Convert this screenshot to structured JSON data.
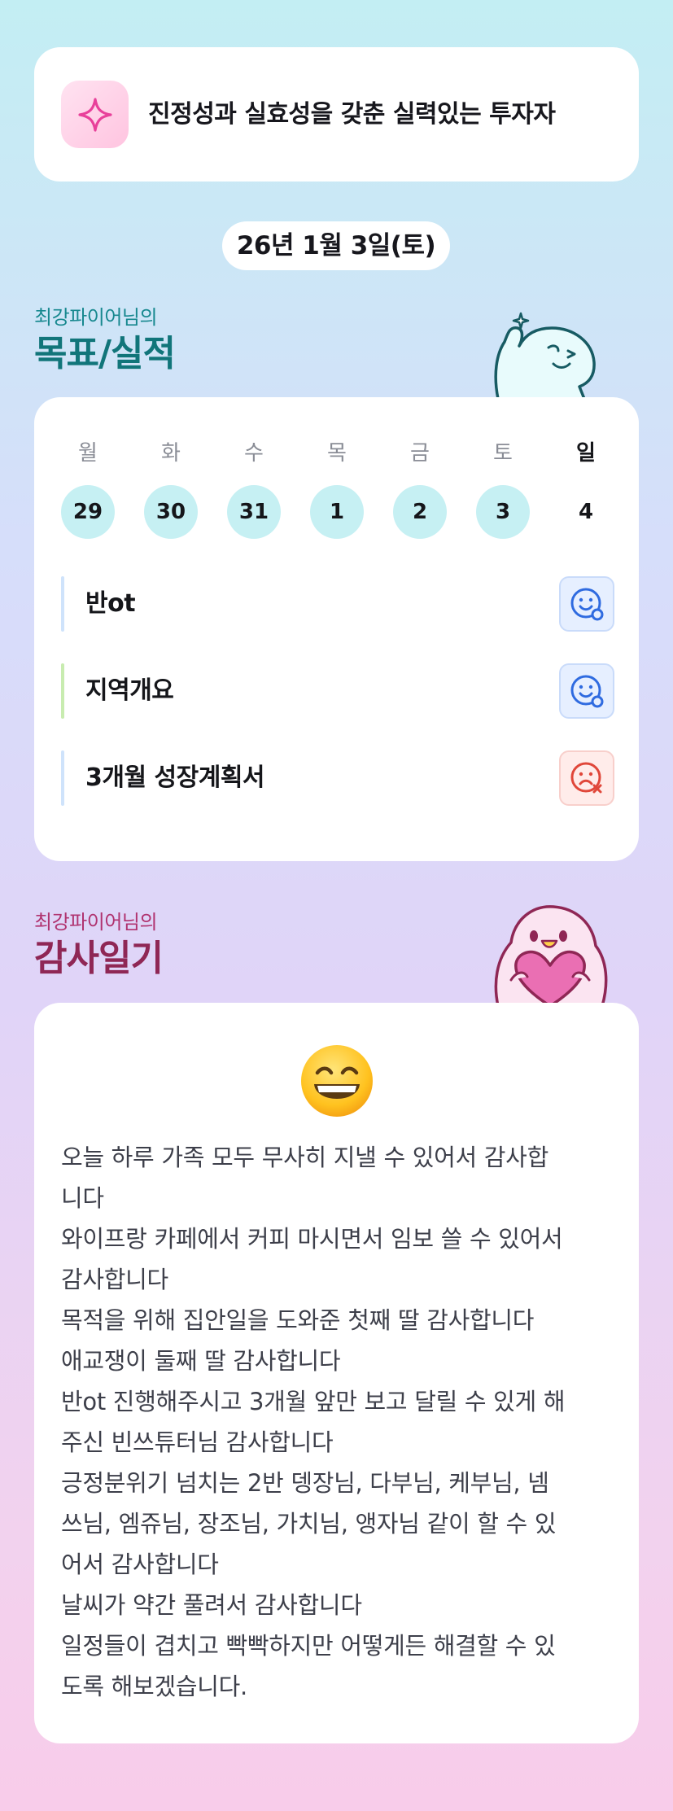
{
  "motto": {
    "icon": "sparkle-icon",
    "text": "진정성과 실효성을 갖춘 실력있는 투자자"
  },
  "date_label": "26년 1월 3일(토)",
  "goals_section": {
    "subtitle": "최강파이어님의",
    "title": "목표/실적",
    "weekdays": [
      "월",
      "화",
      "수",
      "목",
      "금",
      "토",
      "일"
    ],
    "dates": [
      "29",
      "30",
      "31",
      "1",
      "2",
      "3",
      "4"
    ],
    "tasks": [
      {
        "label": "반ot",
        "status": "smile-icon",
        "bar_color": "#cfe3fb"
      },
      {
        "label": "지역개요",
        "status": "smile-icon",
        "bar_color": "#c8ecb0"
      },
      {
        "label": "3개월 성장계획서",
        "status": "sad-x-icon",
        "bar_color": "#cfe3fb"
      }
    ]
  },
  "gratitude_section": {
    "subtitle": "최강파이어님의",
    "title": "감사일기",
    "emoji": "grinning-face-icon",
    "lines": [
      "오늘 하루 가족 모두 무사히 지낼 수 있어서 감사합",
      "니다",
      "와이프랑 카페에서 커피 마시면서 임보 쓸 수 있어서",
      "감사합니다",
      "목적을 위해 집안일을 도와준 첫째 딸 감사합니다",
      "애교쟁이 둘째 딸 감사합니다",
      "반ot 진행해주시고 3개월 앞만 보고 달릴 수 있게 해",
      "주신 빈쓰튜터님 감사합니다",
      "긍정분위기 넘치는 2반 뎅장님, 다부님, 케부님, 넴",
      "쓰님, 엠쥬님, 장조님, 가치님, 앵자님 같이 할 수 있",
      "어서 감사합니다",
      "날씨가 약간 풀려서 감사합니다",
      "일정들이 겹치고 빡빡하지만 어떻게든 해결할 수 있",
      "도록 해보겠습니다."
    ]
  },
  "colors": {
    "accent_teal": "#11757a",
    "accent_magenta": "#8f2755",
    "date_highlight": "#c6f0f3"
  }
}
